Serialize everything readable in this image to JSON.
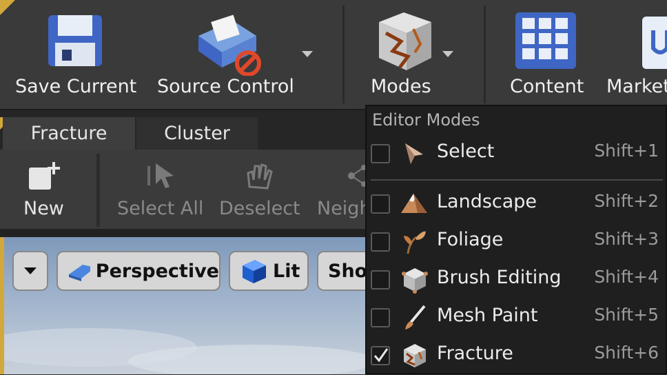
{
  "toolbar": {
    "save_label": "Save Current",
    "source_control_label": "Source Control",
    "modes_label": "Modes",
    "content_label": "Content",
    "marketplace_label": "Market"
  },
  "fracture_panel": {
    "tabs": [
      {
        "label": "Fracture"
      },
      {
        "label": "Cluster"
      }
    ],
    "actions": {
      "new_label": "New",
      "select_all_label": "Select All",
      "deselect_label": "Deselect",
      "neighbors_label": "Neigh"
    }
  },
  "viewport": {
    "perspective_label": "Perspective",
    "lit_label": "Lit",
    "show_label": "Sho"
  },
  "menu": {
    "header": "Editor Modes",
    "items": [
      {
        "label": "Select",
        "shortcut": "Shift+1",
        "checked": false,
        "icon": "cursor-arrow-icon"
      },
      {
        "label": "Landscape",
        "shortcut": "Shift+2",
        "checked": false,
        "icon": "mountain-icon"
      },
      {
        "label": "Foliage",
        "shortcut": "Shift+3",
        "checked": false,
        "icon": "leaf-icon"
      },
      {
        "label": "Brush Editing",
        "shortcut": "Shift+4",
        "checked": false,
        "icon": "cube-icon"
      },
      {
        "label": "Mesh Paint",
        "shortcut": "Shift+5",
        "checked": false,
        "icon": "paintbrush-icon"
      },
      {
        "label": "Fracture",
        "shortcut": "Shift+6",
        "checked": true,
        "icon": "fractured-cube-icon"
      }
    ]
  },
  "colors": {
    "accent_gold": "#d2a83c",
    "menu_bg": "#1f1f1f",
    "toolbar_bg": "#3a3a3a"
  }
}
